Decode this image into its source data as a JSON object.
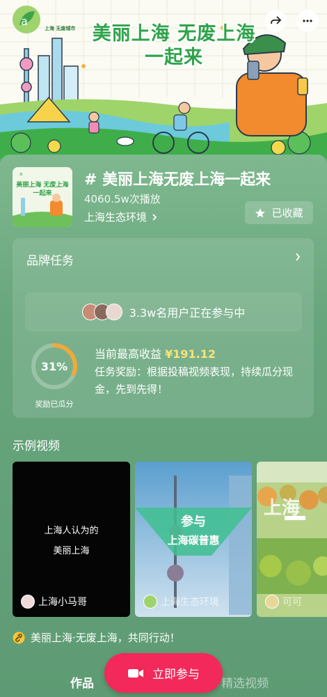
{
  "banner": {
    "title_line1": "美丽上海 无废上海",
    "title_line2": "一起来",
    "logo_text": "上海 无废城市"
  },
  "topic": {
    "title": "# 美丽上海无废上海一起来",
    "plays": "4060.5w次播放",
    "org": "上海生态环境",
    "fav_label": "已收藏",
    "thumb_title": "美丽上海 无废上海 一起来"
  },
  "task": {
    "heading": "品牌任务",
    "participants": "3.3w名用户正在参与中",
    "progress_percent": 31,
    "progress_text": "31%",
    "progress_label": "奖励已瓜分",
    "earn_prefix": "当前最高收益",
    "earn_amount": "¥191.12",
    "reward_text": "任务奖励：根据投稿视频表现，持续瓜分现金，先到先得！"
  },
  "samples": {
    "heading": "示例视频",
    "videos": [
      {
        "text": "上海人认为的\n美丽上海",
        "line1": "上海人认为的",
        "line2": "美丽上海",
        "author": "上海小马哥"
      },
      {
        "overlay1": "参与",
        "overlay2": "上海碳普惠",
        "author": "上海生态环境"
      },
      {
        "overlay": "上海",
        "author": "可可"
      }
    ]
  },
  "slogan": "美丽上海·无废上海，共同行动！",
  "bottom": {
    "tab_works": "作品",
    "join_label": "立即参与",
    "tab_featured": "精选视频"
  },
  "colors": {
    "accent_pink": "#f2295a",
    "earn_yellow": "#f7e37a",
    "ring_orange": "#f0a93b",
    "title_green": "#2fa34a"
  },
  "icons": [
    "back-icon",
    "share-icon",
    "star-icon",
    "chevron-right-icon",
    "camera-icon",
    "link-icon"
  ]
}
